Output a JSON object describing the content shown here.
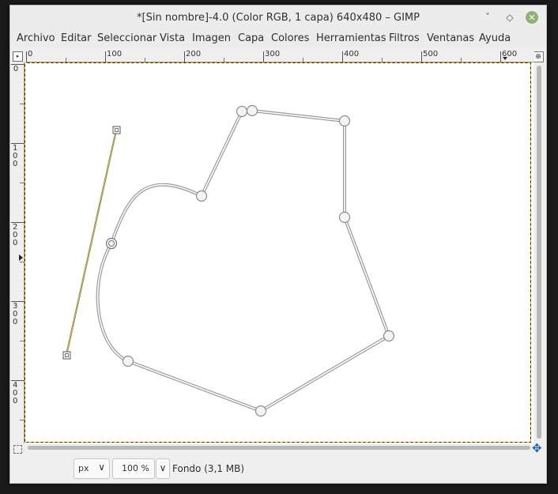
{
  "window": {
    "title": "*[Sin nombre]-4.0 (Color RGB, 1 capa) 640x480 – GIMP"
  },
  "window_buttons": {
    "minimize_glyph": "ˇ",
    "maximize_glyph": "◇",
    "close_glyph": "✕"
  },
  "menu": {
    "items": [
      "Archivo",
      "Editar",
      "Seleccionar",
      "Vista",
      "Imagen",
      "Capa",
      "Colores",
      "Herramientas",
      "Filtros",
      "Ventanas",
      "Ayuda"
    ]
  },
  "rulers": {
    "horizontal_labels": [
      "0",
      "100",
      "200",
      "300",
      "400",
      "500",
      "600"
    ],
    "vertical_labels": [
      "0",
      "100",
      "200",
      "300",
      "400"
    ]
  },
  "corner_icons": {
    "ruler_menu": "▸",
    "zoom_toggle": "⊕",
    "navigate": "✥"
  },
  "status": {
    "unit": "px",
    "unit_chevron": "∨",
    "zoom": "100 %",
    "zoom_chevron": "∨",
    "layer": "Fondo (3,1 MB)"
  },
  "colors": {
    "selection_dash": "#f0c400",
    "path_stroke": "#8a8a8a",
    "handle_line": "#b59b4e",
    "close_button": "#8cb27a",
    "navigate_icon": "#1d5fa7"
  }
}
